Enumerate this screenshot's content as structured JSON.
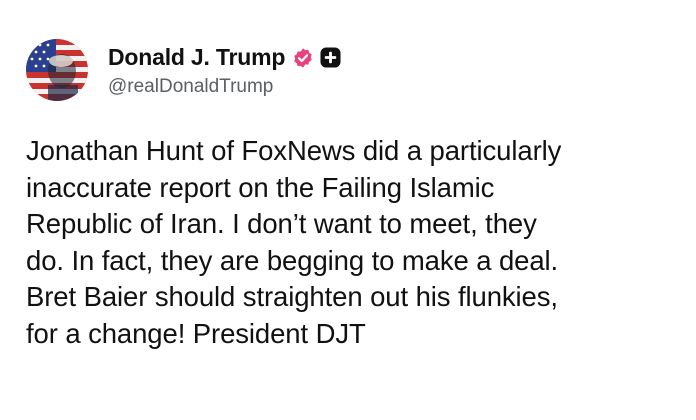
{
  "post": {
    "author": {
      "display_name": "Donald J. Trump",
      "handle": "@realDonaldTrump",
      "avatar": "flag-portrait-avatar",
      "verified_icon": "verified-badge-icon",
      "verified_color": "#e6437e",
      "extra_icon": "plus-square-icon"
    },
    "body_lines": [
      "Jonathan Hunt of FoxNews did a particularly",
      "inaccurate report on the Failing Islamic",
      "Republic of Iran. I don’t want to meet, they",
      "do. In fact, they are begging to make a deal.",
      "Bret Baier should straighten out his flunkies,",
      "for a change! President DJT"
    ]
  },
  "colors": {
    "text": "#111111",
    "handle": "#5b5f66",
    "background": "#ffffff",
    "badge": "#e6437e"
  }
}
